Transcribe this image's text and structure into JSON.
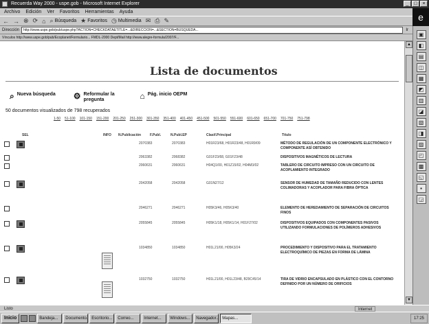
{
  "window": {
    "title": "Recuerda Way 2000 - uspe.gob - Microsoft Internet Explorer",
    "min": "_",
    "max": "□",
    "close": "×"
  },
  "menu": [
    "Archivo",
    "Edición",
    "Ver",
    "Favoritos",
    "Herramientas",
    "Ayuda"
  ],
  "toolbar": [
    {
      "icon": "back-icon",
      "label": "←"
    },
    {
      "icon": "forward-icon",
      "label": "→"
    },
    {
      "icon": "stop-icon",
      "label": "⊗"
    },
    {
      "icon": "refresh-icon",
      "label": "⟳"
    },
    {
      "icon": "home-icon",
      "label": "⌂"
    },
    {
      "icon": "search-icon",
      "label": "Búsqueda"
    },
    {
      "icon": "favorites-icon",
      "label": "Favoritos"
    },
    {
      "icon": "history-icon",
      "label": "Multimedia"
    },
    {
      "icon": "mail-icon",
      "label": "✉"
    },
    {
      "icon": "print-icon",
      "label": "⎙"
    },
    {
      "icon": "edit-icon",
      "label": "✎"
    }
  ],
  "address": {
    "label": "Dirección",
    "value": "http://www.uspe.gob/pub/uspe.php?ACTION=CHECKDATA&TITLE=...&DIRECCION=...&SECTION=BUSQUEDA...",
    "go": "Ir"
  },
  "links_bar": "Vínculos  http://www.uspe.gob/pub/Ecoplanet/Formulario...  FMDL-2000  Dept/Mail  http://www.alegre-formula/2007/F...",
  "page": {
    "title": "Lista de documentos",
    "nav": [
      {
        "icon": "search-icon",
        "label": "Nueva búsqueda"
      },
      {
        "icon": "reformulate-icon",
        "label": "Reformular la pregunta"
      },
      {
        "icon": "home-icon",
        "label": "Pág. inicio OEPM"
      }
    ],
    "summary": "50 documentos visualizados de 798 recuperados",
    "pages": [
      "1-50",
      "51-100",
      "101-150",
      "151-200",
      "201-250",
      "251-300",
      "301-350",
      "351-400",
      "401-450",
      "451-500",
      "501-550",
      "551-600",
      "601-650",
      "651-700",
      "701-750",
      "751-798"
    ],
    "columns": {
      "sel": "SEL",
      "info": "INFO",
      "pub": "N.Publicación",
      "pubdate": "F.Publ.",
      "cip": "N.Publ.EP",
      "class": "Clasif.Principal",
      "title": "Título"
    },
    "rows": [
      {
        "pub": "2070383",
        "date": "2070383",
        "class": "H01R23/68, H01R23/48, H01R9/09",
        "title": "MÉTODO DE REGULACIÓN DE UN COMPONENTE ELECTRÓNICO Y COMPONENTE ASÍ OBTENIDO"
      },
      {
        "pub": "2063382",
        "date": "2068382",
        "class": "G01F23/68, G01F23/48",
        "title": "DISPOSITIVOS MAGNÉTICOS DE LECTURA"
      },
      {
        "pub": "2060631",
        "date": "2060631",
        "class": "H04Q1/00, H01Z15/02, H04M3/02",
        "title": "TABLERO DE CIRCUITO IMPRESO CON UN CIRCUITO DE ACOPLAMIENTO INTEGRADO"
      },
      {
        "pub": "2042058",
        "date": "2042058",
        "class": "G01N27/12",
        "title": "SENSOR DE HUMEDAD DE TAMAÑO REDUCIDO CON LENTES COLIMADORAS Y ACOPLADOR PARA FIBRA ÓPTICA"
      },
      {
        "pub": "2046271",
        "date": "2046271",
        "class": "H05K3/46, H05K3/40",
        "title": "ELEMENTO DE HEREDAMIENTO DE SEPARACIÓN DE CIRCUITOS FINOS"
      },
      {
        "pub": "2055845",
        "date": "2055845",
        "class": "H05K1/18, H05K1/14, H01F27/02",
        "title": "DISPOSITIVOS EQUIPADOS CON COMPONENTES PASIVOS UTILIZANDO FORMULACIONES DE POLÍMEROS ADHESIVOS"
      },
      {
        "pub": "1034850",
        "date": "1034850",
        "class": "H01L21/00, H05K3/24",
        "title": "PROCEDIMIENTO Y DISPOSITIVO PARA EL TRATAMIENTO ELECTROQUÍMICO DE PIEZAS EN FORMA DE LÁMINA"
      },
      {
        "pub": "1032750",
        "date": "1032750",
        "class": "H01L21/00, H01L23/48, B29C45/14",
        "title": "TIRA DE VIDRIO ENCAPSULADO EN PLÁSTICO CON EL CONTORNO DEFINIDO POR UN NÚMERO DE ORIFICIOS"
      }
    ]
  },
  "status": {
    "text": "Listo",
    "zone": "Internet"
  },
  "taskbar": {
    "start": "Inicio",
    "tasks": [
      "Bandeja...",
      "Documento...",
      "Escritorio...",
      "Correo...",
      "Internet...",
      "Windows...",
      "Navegador..."
    ],
    "active": "Mapas...",
    "clock": "17:25"
  }
}
